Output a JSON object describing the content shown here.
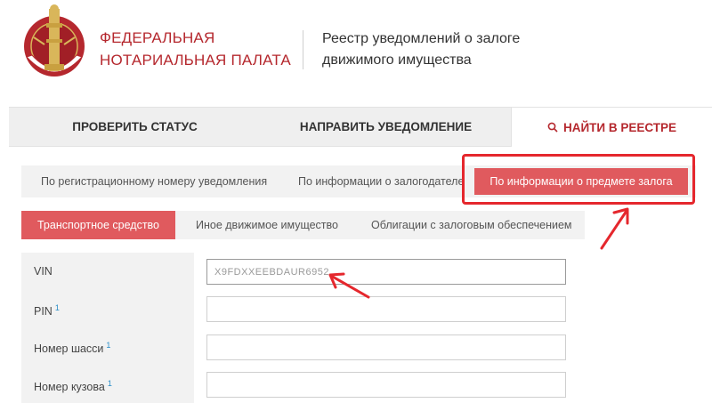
{
  "header": {
    "org_name_line1": "ФЕДЕРАЛЬНАЯ",
    "org_name_line2": "НОТАРИАЛЬНАЯ ПАЛАТА",
    "registry_title_line1": "Реестр уведомлений о залоге",
    "registry_title_line2": "движимого имущества",
    "logo_icon": "notary-chamber-emblem",
    "brand_color": "#b5282e"
  },
  "main_tabs": [
    {
      "label": "ПРОВЕРИТЬ СТАТУС"
    },
    {
      "label": "НАПРАВИТЬ УВЕДОМЛЕНИЕ"
    },
    {
      "label": "НАЙТИ В РЕЕСТРЕ",
      "icon": "search-icon",
      "active": true
    }
  ],
  "search_tabs": [
    {
      "label": "По регистрационному номеру уведомления"
    },
    {
      "label": "По информации о залогодателе"
    },
    {
      "label": "По информации о предмете залога",
      "active": true
    }
  ],
  "property_tabs": [
    {
      "label": "Транспортное средство",
      "active": true
    },
    {
      "label": "Иное движимое имущество"
    },
    {
      "label": "Облигации с залоговым обеспечением"
    }
  ],
  "form": {
    "fields": [
      {
        "label": "VIN",
        "value": "X9FDXXEEBDAUR6952",
        "footnote": ""
      },
      {
        "label": "PIN",
        "value": "",
        "footnote": "1"
      },
      {
        "label": "Номер шасси",
        "value": "",
        "footnote": "1"
      },
      {
        "label": "Номер кузова",
        "value": "",
        "footnote": "1"
      }
    ]
  },
  "colors": {
    "accent": "#e05a5e",
    "annotation": "#e5272d",
    "footnote": "#2a8ec8"
  }
}
